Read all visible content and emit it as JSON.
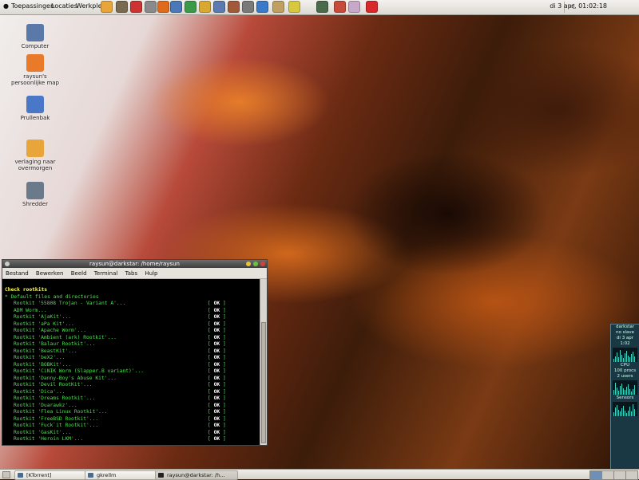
{
  "top_panel": {
    "menus": [
      "Toepassingen",
      "Locaties",
      "Werkplek"
    ],
    "clock": "di 3 apr, 01:02:18",
    "launchers": [
      {
        "name": "folder-icon",
        "color": "#e8a53a"
      },
      {
        "name": "gimp-icon",
        "color": "#7a6a50"
      },
      {
        "name": "clock-icon",
        "color": "#cc3333"
      },
      {
        "name": "network-icon",
        "color": "#8a8a8a"
      },
      {
        "name": "firefox-icon",
        "color": "#e06a1c"
      },
      {
        "name": "mail-icon",
        "color": "#4a78b8"
      },
      {
        "name": "chart-icon",
        "color": "#3a9a4a"
      },
      {
        "name": "person-icon",
        "color": "#d9a830"
      },
      {
        "name": "keyboard-icon",
        "color": "#5a7ab0"
      },
      {
        "name": "tools-icon",
        "color": "#a05a3a"
      },
      {
        "name": "scanner-icon",
        "color": "#7a7a7a"
      },
      {
        "name": "draw-icon",
        "color": "#3a7ac8"
      },
      {
        "name": "dictionary-icon",
        "color": "#c0a060"
      },
      {
        "name": "notes-icon",
        "color": "#d8c840"
      },
      {
        "name": "monitor-icon",
        "color": "#4a6a4a"
      },
      {
        "name": "text-icon",
        "color": "#c84a3a"
      },
      {
        "name": "disc-icon",
        "color": "#c8a8c8"
      },
      {
        "name": "antivirus-icon",
        "color": "#d82a2a"
      }
    ]
  },
  "desktop_icons": [
    {
      "label": "Computer",
      "color": "#5a78a8"
    },
    {
      "label": "raysun's persoonlijke map",
      "color": "#e87a2a"
    },
    {
      "label": "Prullenbak",
      "color": "#4a78c8"
    },
    {
      "label": "verlaging naar overmorgen",
      "color": "#e8a53a"
    },
    {
      "label": "Shredder",
      "color": "#6a7a8a"
    }
  ],
  "terminal": {
    "title": "raysun@darkstar: /home/raysun",
    "menu": [
      "Bestand",
      "Bewerken",
      "Beeld",
      "Terminal",
      "Tabs",
      "Hulp"
    ],
    "heading": "Check rootkits",
    "subheading": "* Default files and directories",
    "ok_label": "OK",
    "rows": [
      "Rootkit '55808 Trojan - Variant A'...",
      "ADM Worm...",
      "Rootkit 'AjaKit'...",
      "Rootkit 'aPa Kit'...",
      "Rootkit 'Apache Worm'...",
      "Rootkit 'Ambient (ark) Rootkit'...",
      "Rootkit 'Balaur Rootkit'...",
      "Rootkit 'BeastKit'...",
      "Rootkit 'beX2'...",
      "Rootkit 'BOBKit'...",
      "Rootkit 'CiNIK Worm (Slapper.B variant)'...",
      "Rootkit 'Danny-Boy's Abuse Kit'...",
      "Rootkit 'Devil RootKit'...",
      "Rootkit 'Dica'...",
      "Rootkit 'Dreams Rootkit'...",
      "Rootkit 'Duarawkz'...",
      "Rootkit 'Flea Linux Rootkit'...",
      "Rootkit 'FreeBSD Rootkit'...",
      "Rootkit 'Fuck`it Rootkit'...",
      "Rootkit 'GasKit'...",
      "Rootkit 'Heroin LKM'..."
    ]
  },
  "gkrellm": {
    "lines": [
      "darkstar",
      "no slave",
      "di 3 apr",
      "1:02"
    ],
    "cpu_label": "CPU",
    "proc_label": "100 procs",
    "users_label": "2 users",
    "sensors_label": "Sensors"
  },
  "taskbar": {
    "tasks": [
      "[KTorrent]",
      "gkrellm",
      "raysun@darkstar: /h..."
    ]
  }
}
